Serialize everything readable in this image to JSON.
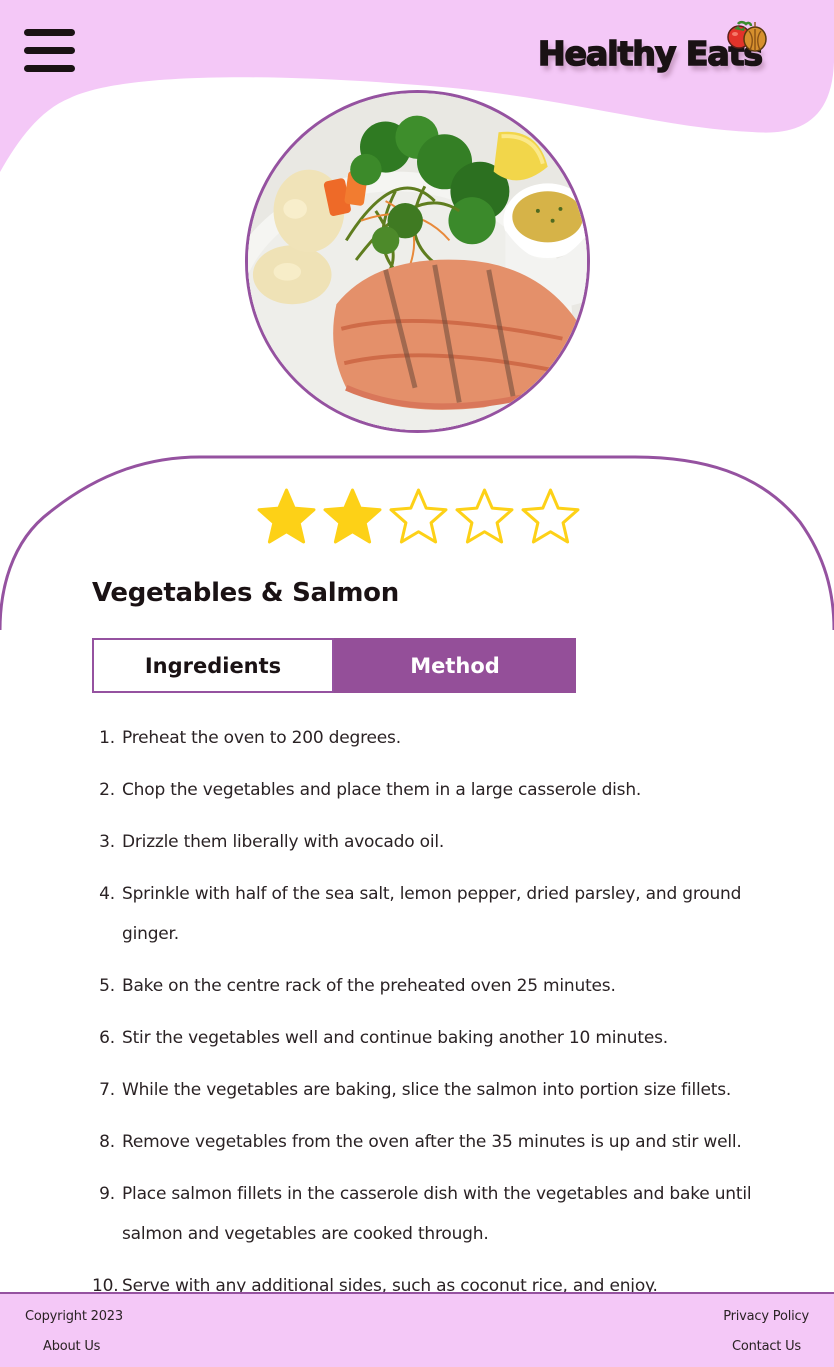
{
  "header": {
    "brand_name": "Healthy Eats",
    "menu_icon": "hamburger-menu-icon",
    "logo_icon": "vegetables-icon"
  },
  "recipe": {
    "title": "Vegetables & Salmon",
    "image_icon": "salmon-dish-photo",
    "rating": {
      "value": 2,
      "max": 5
    }
  },
  "tabs": [
    {
      "label": "Ingredients",
      "active": false
    },
    {
      "label": "Method",
      "active": true
    }
  ],
  "method_steps": [
    {
      "num": "1.",
      "text": "Preheat the oven to 200 degrees."
    },
    {
      "num": "2.",
      "text": "Chop the vegetables and place them in a large casserole dish."
    },
    {
      "num": "3.",
      "text": "Drizzle them liberally with avocado oil."
    },
    {
      "num": "4.",
      "text": "Sprinkle with half of the sea salt, lemon pepper, dried parsley, and ground ginger."
    },
    {
      "num": "5.",
      "text": "Bake on the centre rack of the preheated oven 25 minutes."
    },
    {
      "num": "6.",
      "text": "Stir the vegetables well and continue baking another 10 minutes."
    },
    {
      "num": "7.",
      "text": "While the vegetables are baking, slice the salmon into portion size fillets."
    },
    {
      "num": "8.",
      "text": "Remove vegetables from the oven after the 35 minutes is up and stir well."
    },
    {
      "num": "9.",
      "text": "Place salmon fillets in the casserole dish with the vegetables and bake until salmon and vegetables are cooked through."
    },
    {
      "num": "10.",
      "text": "Serve with any additional sides, such as coconut rice, and enjoy."
    }
  ],
  "footer": {
    "copyright": "Copyright 2023",
    "about": "About Us",
    "privacy": "Privacy Policy",
    "contact": "Contact Us"
  },
  "colors": {
    "header_pink": "#f4c8f7",
    "accent_purple": "#944f99",
    "star_gold": "#fdd117",
    "text_dark": "#1a1214"
  }
}
